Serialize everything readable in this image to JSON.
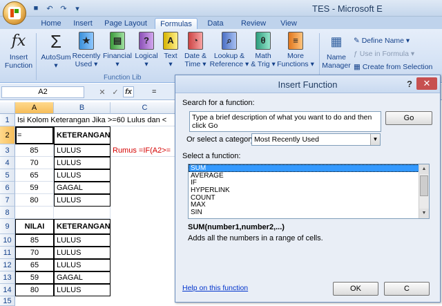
{
  "window": {
    "title": "TES - Microsoft E"
  },
  "tabs": [
    "Home",
    "Insert",
    "Page Layout",
    "Formulas",
    "Data",
    "Review",
    "View"
  ],
  "ribbon": {
    "buttons": [
      {
        "label1": "Insert",
        "label2": "Function",
        "icon": "fx-icon"
      },
      {
        "label1": "AutoSum",
        "label2": "▾",
        "icon": "sigma-icon"
      },
      {
        "label1": "Recently",
        "label2": "Used ▾",
        "icon": "star-book-icon"
      },
      {
        "label1": "Financial",
        "label2": "▾",
        "icon": "financial-book-icon"
      },
      {
        "label1": "Logical",
        "label2": "▾",
        "icon": "logical-book-icon"
      },
      {
        "label1": "Text",
        "label2": "▾",
        "icon": "text-book-icon"
      },
      {
        "label1": "Date &",
        "label2": "Time ▾",
        "icon": "date-book-icon"
      },
      {
        "label1": "Lookup &",
        "label2": "Reference ▾",
        "icon": "lookup-book-icon"
      },
      {
        "label1": "Math",
        "label2": "& Trig ▾",
        "icon": "math-book-icon"
      },
      {
        "label1": "More",
        "label2": "Functions ▾",
        "icon": "more-book-icon"
      },
      {
        "label1": "Name",
        "label2": "Manager",
        "icon": "name-manager-icon"
      }
    ],
    "group_label": "Function Lib",
    "names": {
      "define": "Define Name ▾",
      "use_in_formula": "Use in Formula ▾",
      "create": "Create from Selection"
    }
  },
  "formula_bar": {
    "name_box": "A2",
    "content": "="
  },
  "columns": [
    "A",
    "B",
    "C"
  ],
  "sheet": {
    "row1_text": "Isi Kolom Keterangan Jika >=60 Lulus dan <",
    "a2": "=",
    "header_keterangan": "KETERANGAN",
    "rumus_label": "Rumus =IF(A2>=",
    "table1": [
      {
        "nilai": "85",
        "ket": "LULUS"
      },
      {
        "nilai": "70",
        "ket": "LULUS"
      },
      {
        "nilai": "65",
        "ket": "LULUS"
      },
      {
        "nilai": "59",
        "ket": "GAGAL"
      },
      {
        "nilai": "80",
        "ket": "LULUS"
      }
    ],
    "header_nilai": "NILAI",
    "table2": [
      {
        "nilai": "85",
        "ket": "LULUS"
      },
      {
        "nilai": "70",
        "ket": "LULUS"
      },
      {
        "nilai": "65",
        "ket": "LULUS"
      },
      {
        "nilai": "59",
        "ket": "GAGAL"
      },
      {
        "nilai": "80",
        "ket": "LULUS"
      }
    ],
    "row_numbers": [
      "1",
      "2",
      "3",
      "4",
      "5",
      "6",
      "7",
      "8",
      "9",
      "10",
      "11",
      "12",
      "13",
      "14",
      "15"
    ]
  },
  "dialog": {
    "title": "Insert Function",
    "help_glyph": "?",
    "close_glyph": "✕",
    "search_label": "Search for a function:",
    "search_value": "Type a brief description of what you want to do and then click Go",
    "go_button": "Go",
    "category_label": "Or select a category:",
    "category_value": "Most Recently Used",
    "select_label": "Select a function:",
    "functions": [
      "SUM",
      "AVERAGE",
      "IF",
      "HYPERLINK",
      "COUNT",
      "MAX",
      "SIN"
    ],
    "signature": "SUM(number1,number2,...)",
    "description": "Adds all the numbers in a range of cells.",
    "help_link": "Help on this function",
    "ok": "OK",
    "cancel": "C"
  }
}
